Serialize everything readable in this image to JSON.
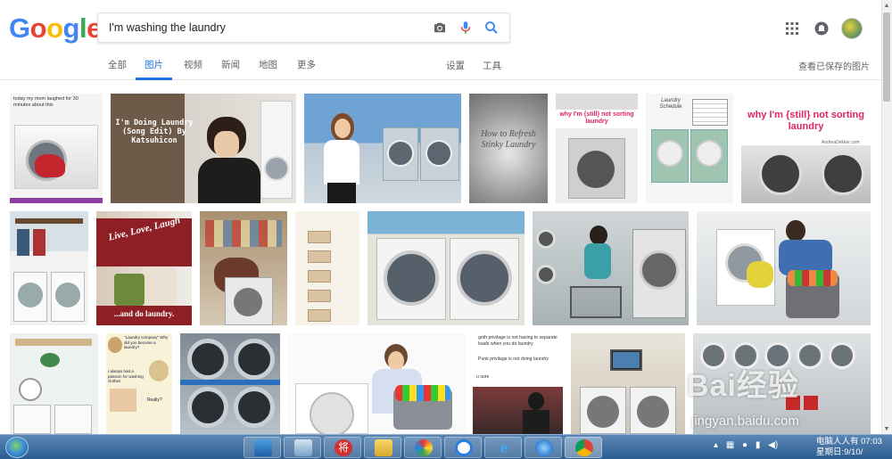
{
  "header": {
    "logo_letters": [
      {
        "ch": "G",
        "color": "#4285f4"
      },
      {
        "ch": "o",
        "color": "#ea4335"
      },
      {
        "ch": "o",
        "color": "#fbbc05"
      },
      {
        "ch": "g",
        "color": "#4285f4"
      },
      {
        "ch": "l",
        "color": "#34a853"
      },
      {
        "ch": "e",
        "color": "#ea4335"
      }
    ],
    "search_value": "I'm washing the laundry",
    "icons": [
      "camera-icon",
      "microphone-icon",
      "search-icon",
      "apps-grid-icon",
      "notifications-icon",
      "avatar"
    ]
  },
  "tabs": [
    {
      "label": "全部",
      "active": false
    },
    {
      "label": "图片",
      "active": true
    },
    {
      "label": "视频",
      "active": false
    },
    {
      "label": "新闻",
      "active": false
    },
    {
      "label": "地图",
      "active": false
    },
    {
      "label": "更多",
      "active": false
    }
  ],
  "tools": {
    "settings": "设置",
    "tools": "工具"
  },
  "saved_images": "查看已保存的图片",
  "captions": {
    "t1": "today my mom laughed for 30 minutes about this",
    "t2": "I'm Doing Laundry (Song Edit) By Katsuhicon",
    "t4": "How to Refresh Stinky Laundry",
    "t5": "why I'm {still} not sorting laundry",
    "t6": "Laundry Schedule",
    "t7": "why I'm {still} not sorting laundry",
    "t7b": "AndreaDekker.com",
    "t9": "Live, Love, Laugh",
    "t9b": "...and do laundry.",
    "t16a": "\"Laundry company\" Why did you become a laundry?",
    "t16b": "I always had a passion for washing clothes",
    "t16c": "Really?",
    "t19a": "goth privilage is not having to separate loads when you do laundry",
    "t19b": "Punk privilage is not doing laundry",
    "t19c": "u sure"
  },
  "watermark": {
    "brand": "Bai经验",
    "url": "jingyan.baidu.com"
  },
  "taskbar": {
    "clock_line1": "电脑人人有 07:03",
    "clock_line2": "星期日:9/10/",
    "pinned": [
      "desktop",
      "control-panel",
      "chess-app",
      "folder",
      "paint",
      "sogou",
      "ie",
      "gear",
      "chrome"
    ]
  },
  "colors": {
    "accent": "#1a73e8",
    "taskbar": "#2c5c8f"
  }
}
